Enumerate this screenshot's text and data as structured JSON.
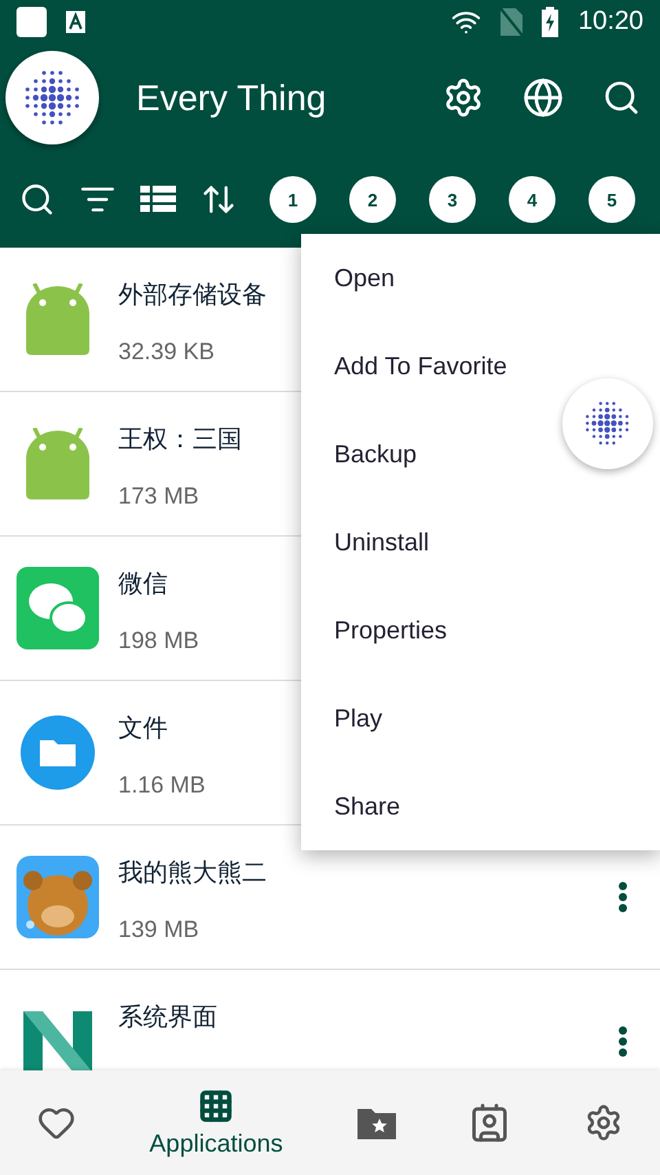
{
  "status_bar": {
    "time": "10:20"
  },
  "header": {
    "title": "Every Thing"
  },
  "toolbar": {
    "chips": [
      "1",
      "2",
      "3",
      "4",
      "5"
    ]
  },
  "apps": [
    {
      "name": "外部存储设备",
      "size": "32.39 KB",
      "kind": "android",
      "under_menu": true
    },
    {
      "name": "王权：三国",
      "size": "173 MB",
      "kind": "android",
      "under_menu": true
    },
    {
      "name": "微信",
      "size": "198 MB",
      "kind": "chat",
      "under_menu": true
    },
    {
      "name": "文件",
      "size": "1.16 MB",
      "kind": "folder",
      "under_menu": true
    },
    {
      "name": "我的熊大熊二",
      "size": "139 MB",
      "kind": "picture",
      "under_menu": false
    },
    {
      "name": "系统界面",
      "kind": "n-logo",
      "under_menu": false
    }
  ],
  "context_menu": [
    "Open",
    "Add To Favorite",
    "Backup",
    "Uninstall",
    "Properties",
    "Play",
    "Share"
  ],
  "bottom_nav": [
    {
      "kind": "heart",
      "selected": false
    },
    {
      "kind": "grid",
      "label": "Applications",
      "selected": true
    },
    {
      "kind": "folder-star",
      "selected": false
    },
    {
      "kind": "contact",
      "selected": false
    },
    {
      "kind": "gear",
      "selected": false
    }
  ]
}
